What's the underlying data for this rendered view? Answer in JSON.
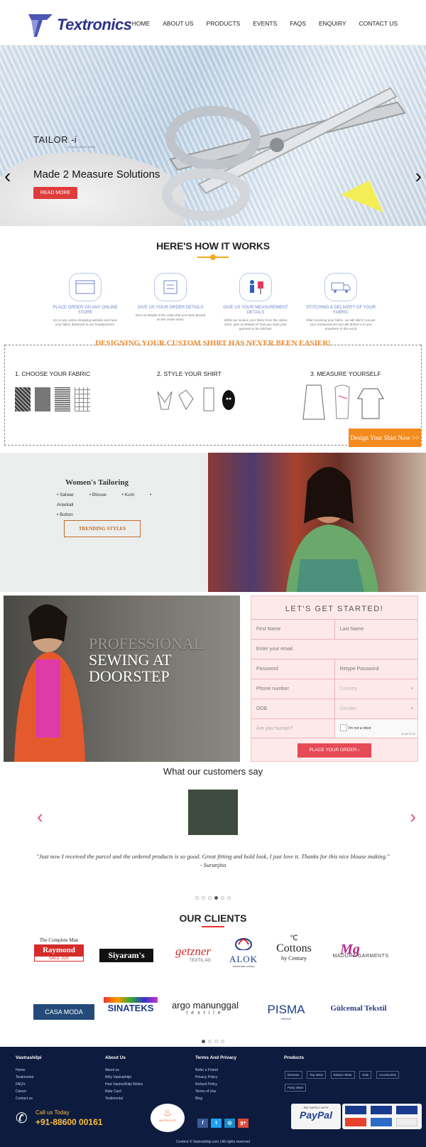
{
  "header": {
    "brand": "Textronics",
    "nav": [
      "HOME",
      "ABOUT US",
      "PRODUCTS",
      "EVENTS",
      "FAQS",
      "ENQUIRY",
      "CONTACT US"
    ]
  },
  "hero": {
    "tailor": "TAILOR -i",
    "tailor_sub": "virtual tailor shop",
    "title": "Made 2 Measure Solutions",
    "button": "READ MORE"
  },
  "how": {
    "title": "HERE'S HOW IT WORKS",
    "steps": [
      {
        "title": "PLACE ORDER ON ANY ONLINE STORE",
        "desc": "Go to any online shopping website and have your fabric delivered to our headquarters."
      },
      {
        "title": "GIVE US YOUR ORDER DETAILS",
        "desc": "Give us details of the order that you have placed on the online store."
      },
      {
        "title": "GIVE US YOUR MEASUREMENT DETAILS",
        "desc": "While we receive your fabric from the online store, give us details on how you want your garment to be stitched."
      },
      {
        "title": "STITCHING & DELIVERY OF YOUR FABRIC",
        "desc": "After receiving your fabric, we will stitch it as per your measurement and will deliver it to you anywhere in the world"
      }
    ]
  },
  "design": {
    "title": "DESIGNING YOUR CUSTOM SHIRT HAS NEVER BEEN EASIER!",
    "step1": "1. CHOOSE YOUR FABRIC",
    "step2": "2. STYLE YOUR SHIRT",
    "step3": "3. MEASURE YOURSELF",
    "button": "Design Your Shirt Now >>"
  },
  "women": {
    "title": "Women's Tailoring",
    "items": [
      "Salwar",
      "Blouse",
      "Kurti",
      "Anarkali",
      "Botton"
    ],
    "button": "TRENDING STYLES"
  },
  "pro": {
    "line1": "PROFESSIONAL",
    "line2": "SEWING AT",
    "line3": "DOORSTEP"
  },
  "form": {
    "title": "LET'S GET STARTED!",
    "first": "First Name",
    "last": "Last Name",
    "email": "Enter your email",
    "pass": "Password",
    "repass": "Retype Password",
    "phone": "Phone number",
    "country": "Country",
    "dob": "DOB",
    "gender": "Gender",
    "human": "Are you human?",
    "robot": "I'm not a robot",
    "recap": "reCAPTCHA",
    "button": "PLACE YOUR ORDER"
  },
  "customers": {
    "title": "What our customers say",
    "quote": "\"Just now I received the parcel and the ordered products is so good. Great fitting and bold look, I just love it. Thanks for this nice blouse making.\"",
    "author": "- Suranjita"
  },
  "clients": {
    "title": "OUR CLIENTS",
    "brands": [
      "The Complete Man",
      "Raymond",
      "SINCE 1925",
      "Siyaram's",
      "getzner",
      "TEXTIL AG",
      "ALOK",
      "INDUSTRIES LIMITED",
      "Cottons",
      "by Century",
      "MADURA GARMENTS",
      "CASA MODA",
      "SINATEKS",
      "argo manunggal",
      "textile",
      "PISMA",
      "GROUP",
      "Gülcemal Tekstil"
    ]
  },
  "footer": {
    "col1": "Vastrashilpi",
    "col2": "About Us",
    "col3": "Terms And Privacy",
    "col4": "Products",
    "links1": [
      "Home",
      "Testimonial",
      "FAQ's",
      "Career",
      "Contact us"
    ],
    "links2": [
      "About us",
      "Why Vastrashilpi",
      "How VastraShilpi Works",
      "Rate Card",
      "Testimonial"
    ],
    "links3": [
      "Refer a Friend",
      "Privacy Policy",
      "Refund Policy",
      "Terms of Use",
      "Blog"
    ],
    "tags": [
      "Dresses",
      "Top Wear",
      "Bottom Wear",
      "Sale",
      "Accessories",
      "Party Wear"
    ],
    "call": "Call us Today",
    "phone": "+91-88600 00161",
    "logo": "VASTRJYOTI",
    "pay_safe": "PAY SAFELY WITH",
    "paypal": "PayPal",
    "copyright": "Content © Vastrashilpi.com | All rights reserved"
  }
}
